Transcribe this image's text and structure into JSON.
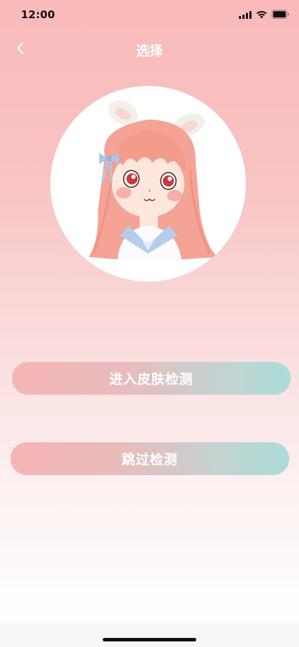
{
  "status_bar": {
    "time": "12:00",
    "icons": [
      "signal-icon",
      "wifi-icon",
      "battery-icon"
    ]
  },
  "nav": {
    "back_icon": "chevron-left-icon",
    "title": "选择"
  },
  "avatar": {
    "description_icon": "girl-with-bunny-ears-avatar"
  },
  "actions": {
    "enter_detection_label": "进入皮肤检测",
    "skip_detection_label": "跳过检测"
  },
  "colors": {
    "gradient_top": "#f9b9b9",
    "gradient_bottom": "#ffffff",
    "button_pink": "#f7b5b5",
    "button_teal": "#aadcd8",
    "text_white": "#ffffff"
  }
}
